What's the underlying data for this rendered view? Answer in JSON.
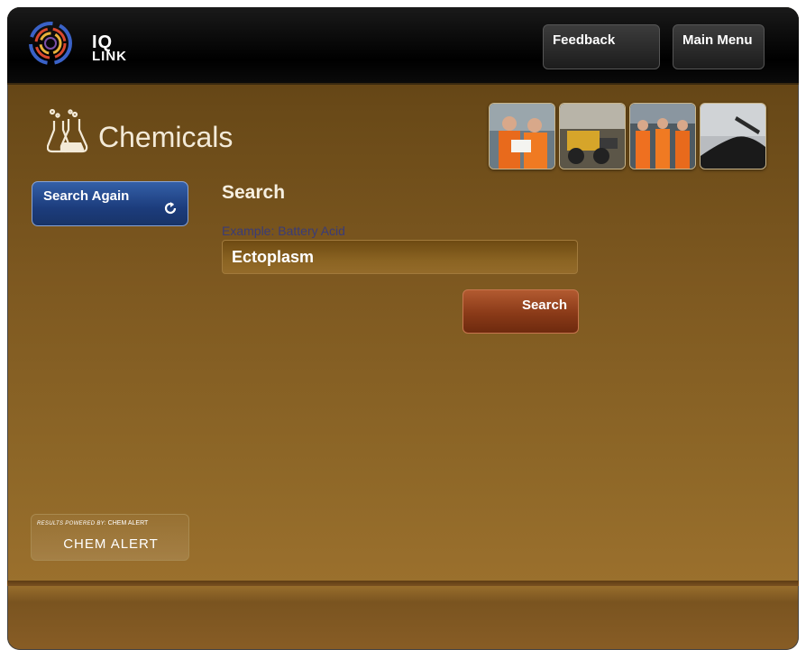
{
  "header": {
    "logo": {
      "line1": "IQ",
      "line2": "LINK"
    },
    "feedback_label": "Feedback",
    "main_menu_label": "Main Menu"
  },
  "page": {
    "title": "Chemicals"
  },
  "sidebar": {
    "search_again_label": "Search Again",
    "powered_by_prefix": "RESULTS POWERED BY:",
    "powered_by_name": "CHEM ALERT",
    "chem_alert_logo": "CHEM ALERT"
  },
  "search": {
    "heading": "Search",
    "example_label": "Example: Battery Acid",
    "input_value": "Ectoplasm",
    "button_label": "Search"
  },
  "icons": {
    "logo": "iq-link-logo-icon",
    "title": "flasks-icon",
    "search_again": "refresh-icon"
  },
  "colors": {
    "accent_blue": "#1f427f",
    "search_button": "#8a3a18",
    "background_brown": "#7d5820"
  }
}
